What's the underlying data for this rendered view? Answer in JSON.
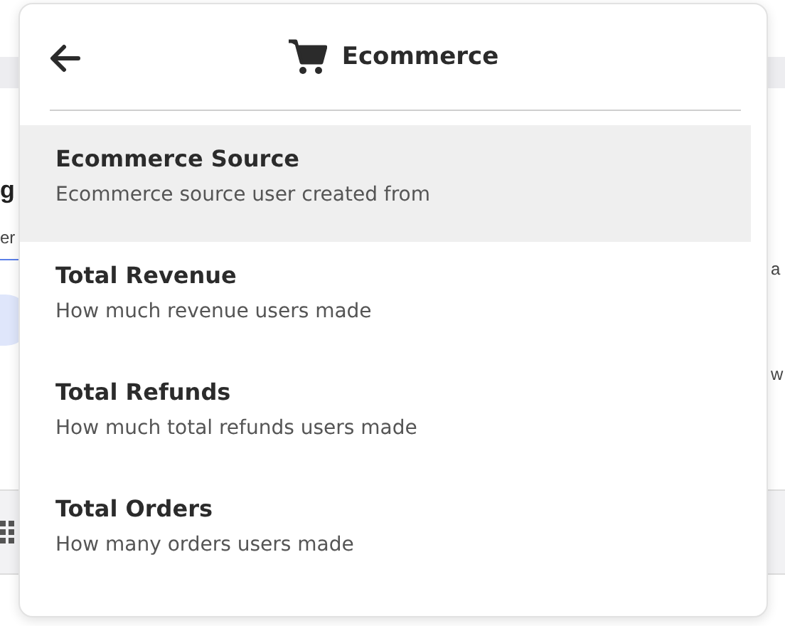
{
  "background": {
    "heading": "g",
    "left_texts": [
      "er"
    ],
    "right_texts": [
      "a",
      "w"
    ]
  },
  "menu": {
    "title": "Ecommerce",
    "items": [
      {
        "title": "Ecommerce Source",
        "description": "Ecommerce source user created from",
        "selected": true
      },
      {
        "title": "Total Revenue",
        "description": "How much revenue users made",
        "selected": false
      },
      {
        "title": "Total Refunds",
        "description": "How much total refunds users made",
        "selected": false
      },
      {
        "title": "Total Orders",
        "description": "How many orders users made",
        "selected": false
      }
    ]
  }
}
